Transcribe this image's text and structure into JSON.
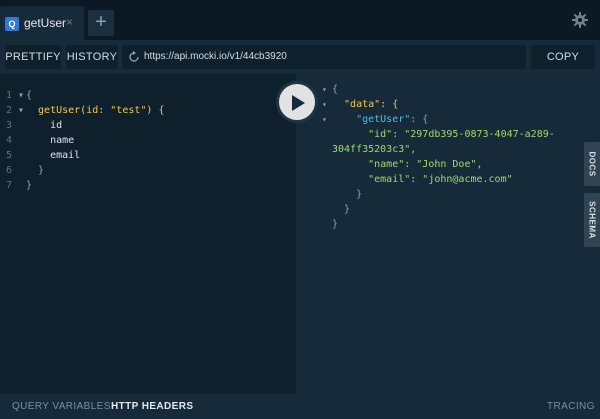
{
  "tabs": [
    {
      "badge": "Q",
      "label": "getUser",
      "close": "×"
    }
  ],
  "tab_add_label": "+",
  "toolbar": {
    "prettify_label": "PRETTIFY",
    "history_label": "HISTORY",
    "url": "https://api.mocki.io/v1/44cb3920",
    "copy_curl_label": "COPY CURL"
  },
  "editor": {
    "line_numbers": [
      "1",
      "2",
      "3",
      "4",
      "5",
      "6",
      "7"
    ],
    "query_lines": [
      "{",
      "  getUser(id: \"test\") {",
      "    id",
      "    name",
      "    email",
      "  }",
      "}"
    ]
  },
  "result": {
    "lines": [
      "{",
      "  \"data\": {",
      "    \"getUser\": {",
      "      \"id\": \"297db395-0873-4047-a289-",
      "304ff35203c3\",",
      "      \"name\": \"John Doe\",",
      "      \"email\": \"john@acme.com\"",
      "    }",
      "  }",
      "}"
    ]
  },
  "side_tabs": {
    "docs": "DOCS",
    "schema": "SCHEMA"
  },
  "footer": {
    "query_variables": "QUERY VARIABLES",
    "http_headers": "HTTP HEADERS",
    "tracing": "TRACING"
  },
  "icons": {
    "play": "play-icon",
    "gear": "gear-icon",
    "refresh": "refresh-icon"
  },
  "colors": {
    "accent_badge": "#2f7ad8",
    "field": "#f1c84c",
    "argument": "#b96fd0",
    "string": "#f0a1d5",
    "property": "#3fc3ee",
    "result_string": "#a0d96a"
  }
}
